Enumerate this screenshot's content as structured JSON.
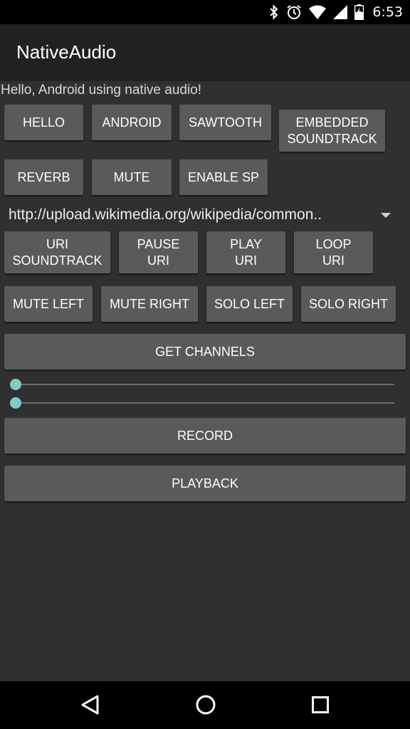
{
  "status_bar": {
    "time": "6:53",
    "icons": [
      "bluetooth-icon",
      "alarm-icon",
      "wifi-icon",
      "cell-signal-icon",
      "battery-charging-icon"
    ]
  },
  "app_bar": {
    "title": "NativeAudio"
  },
  "content": {
    "hello_text": "Hello, Android using native audio!",
    "row1": {
      "hello": "HELLO",
      "android": "ANDROID",
      "sawtooth": "SAWTOOTH",
      "embedded": "EMBEDDED\nSOUNDTRACK"
    },
    "row2": {
      "reverb": "REVERB",
      "mute": "MUTE",
      "enable_sp": "ENABLE SP"
    },
    "uri_spinner": {
      "selected": "http://upload.wikimedia.org/wikipedia/common.."
    },
    "row3": {
      "uri_soundtrack": "URI\nSOUNDTRACK",
      "pause_uri": "PAUSE\nURI",
      "play_uri": "PLAY\nURI",
      "loop_uri": "LOOP\nURI"
    },
    "row4": {
      "mute_left": "MUTE LEFT",
      "mute_right": "MUTE RIGHT",
      "solo_left": "SOLO LEFT",
      "solo_right": "SOLO RIGHT"
    },
    "get_channels": "GET CHANNELS",
    "seekbars": [
      {
        "value": 0
      },
      {
        "value": 0
      }
    ],
    "record": "RECORD",
    "playback": "PLAYBACK"
  },
  "nav_bar": {
    "icons": [
      "back-icon",
      "home-icon",
      "recents-icon"
    ]
  },
  "colors": {
    "accent": "#80cbc4",
    "button": "#5a5a5a",
    "background": "#303030",
    "app_bar": "#212121"
  }
}
